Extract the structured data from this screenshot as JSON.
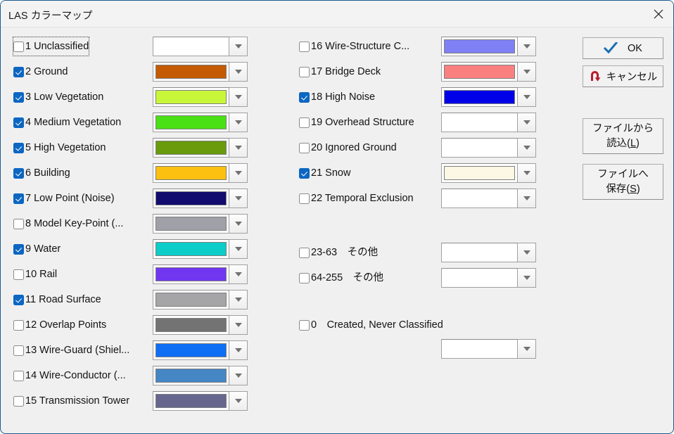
{
  "window": {
    "title": "LAS カラーマップ",
    "close_icon": "close-icon"
  },
  "left_column": [
    {
      "num": "1",
      "name": "Unclassified",
      "label": "1 Unclassified",
      "checked": false,
      "focused": true,
      "color": "#ffffff",
      "empty": true
    },
    {
      "num": "2",
      "name": "Ground",
      "label": "2 Ground",
      "checked": true,
      "focused": false,
      "color": "#c55a04",
      "empty": false
    },
    {
      "num": "3",
      "name": "Low Vegetation",
      "label": "3 Low Vegetation",
      "checked": true,
      "focused": false,
      "color": "#c8f73a",
      "empty": false
    },
    {
      "num": "4",
      "name": "Medium Vegetation",
      "label": "4 Medium Vegetation",
      "checked": true,
      "focused": false,
      "color": "#4ae016",
      "empty": false
    },
    {
      "num": "5",
      "name": "High Vegetation",
      "label": "5 High Vegetation",
      "checked": true,
      "focused": false,
      "color": "#699b0d",
      "empty": false
    },
    {
      "num": "6",
      "name": "Building",
      "label": "6 Building",
      "checked": true,
      "focused": false,
      "color": "#fcc010",
      "empty": false
    },
    {
      "num": "7",
      "name": "Low Point (Noise)",
      "label": "7 Low Point (Noise)",
      "checked": true,
      "focused": false,
      "color": "#120c6e",
      "empty": false
    },
    {
      "num": "8",
      "name": "Model Key-Point",
      "label": "8 Model Key-Point (...",
      "checked": false,
      "focused": false,
      "color": "#a0a0a8",
      "empty": false
    },
    {
      "num": "9",
      "name": "Water",
      "label": "9 Water",
      "checked": true,
      "focused": false,
      "color": "#0ccdc8",
      "empty": false
    },
    {
      "num": "10",
      "name": "Rail",
      "label": "10 Rail",
      "checked": false,
      "focused": false,
      "color": "#7136f0",
      "empty": false
    },
    {
      "num": "11",
      "name": "Road Surface",
      "label": "11 Road Surface",
      "checked": true,
      "focused": false,
      "color": "#a5a5a8",
      "empty": false
    },
    {
      "num": "12",
      "name": "Overlap Points",
      "label": "12 Overlap Points",
      "checked": false,
      "focused": false,
      "color": "#737373",
      "empty": false
    },
    {
      "num": "13",
      "name": "Wire-Guard (Shield)",
      "label": "13 Wire-Guard (Shiel...",
      "checked": false,
      "focused": false,
      "color": "#0e6ff4",
      "empty": false
    },
    {
      "num": "14",
      "name": "Wire-Conductor",
      "label": "14 Wire-Conductor (...",
      "checked": false,
      "focused": false,
      "color": "#4586c4",
      "empty": false
    },
    {
      "num": "15",
      "name": "Transmission Tower",
      "label": "15 Transmission Tower",
      "checked": false,
      "focused": false,
      "color": "#66668f",
      "empty": false
    }
  ],
  "right_column": [
    {
      "num": "16",
      "name": "Wire-Structure Connector",
      "label": "16 Wire-Structure C...",
      "checked": false,
      "color": "#8080f5",
      "empty": false
    },
    {
      "num": "17",
      "name": "Bridge Deck",
      "label": "17 Bridge Deck",
      "checked": false,
      "color": "#fa8080",
      "empty": false
    },
    {
      "num": "18",
      "name": "High Noise",
      "label": "18 High Noise",
      "checked": true,
      "color": "#0000e8",
      "empty": false
    },
    {
      "num": "19",
      "name": "Overhead Structure",
      "label": "19 Overhead Structure",
      "checked": false,
      "color": "#ffffff",
      "empty": true
    },
    {
      "num": "20",
      "name": "Ignored Ground",
      "label": "20 Ignored Ground",
      "checked": false,
      "color": "#ffffff",
      "empty": true
    },
    {
      "num": "21",
      "name": "Snow",
      "label": "21 Snow",
      "checked": true,
      "color": "#fdf7e6",
      "empty": false
    },
    {
      "num": "22",
      "name": "Temporal Exclusion",
      "label": "22 Temporal Exclusion",
      "checked": false,
      "color": "#ffffff",
      "empty": true
    }
  ],
  "range_rows": [
    {
      "name": "range-23-63",
      "label": "23-63　その他",
      "checked": false,
      "color": "#ffffff",
      "empty": true
    },
    {
      "name": "range-64-255",
      "label": "64-255　その他",
      "checked": false,
      "color": "#ffffff",
      "empty": true
    }
  ],
  "created_row": {
    "label": "0　Created, Never Classified",
    "checked": false,
    "color": "#ffffff",
    "empty": true
  },
  "buttons": {
    "ok": {
      "label": "OK",
      "icon": "check-icon",
      "icon_color": "#1a6fb5"
    },
    "cancel": {
      "label": "キャンセル",
      "icon": "undo-arrow-icon",
      "icon_color": "#b81c2e"
    },
    "load": {
      "line1": "ファイルから",
      "line2_pre": "読込(",
      "line2_key": "L",
      "line2_post": ")"
    },
    "save": {
      "line1": "ファイルへ",
      "line2_pre": "保存(",
      "line2_key": "S",
      "line2_post": ")"
    }
  }
}
